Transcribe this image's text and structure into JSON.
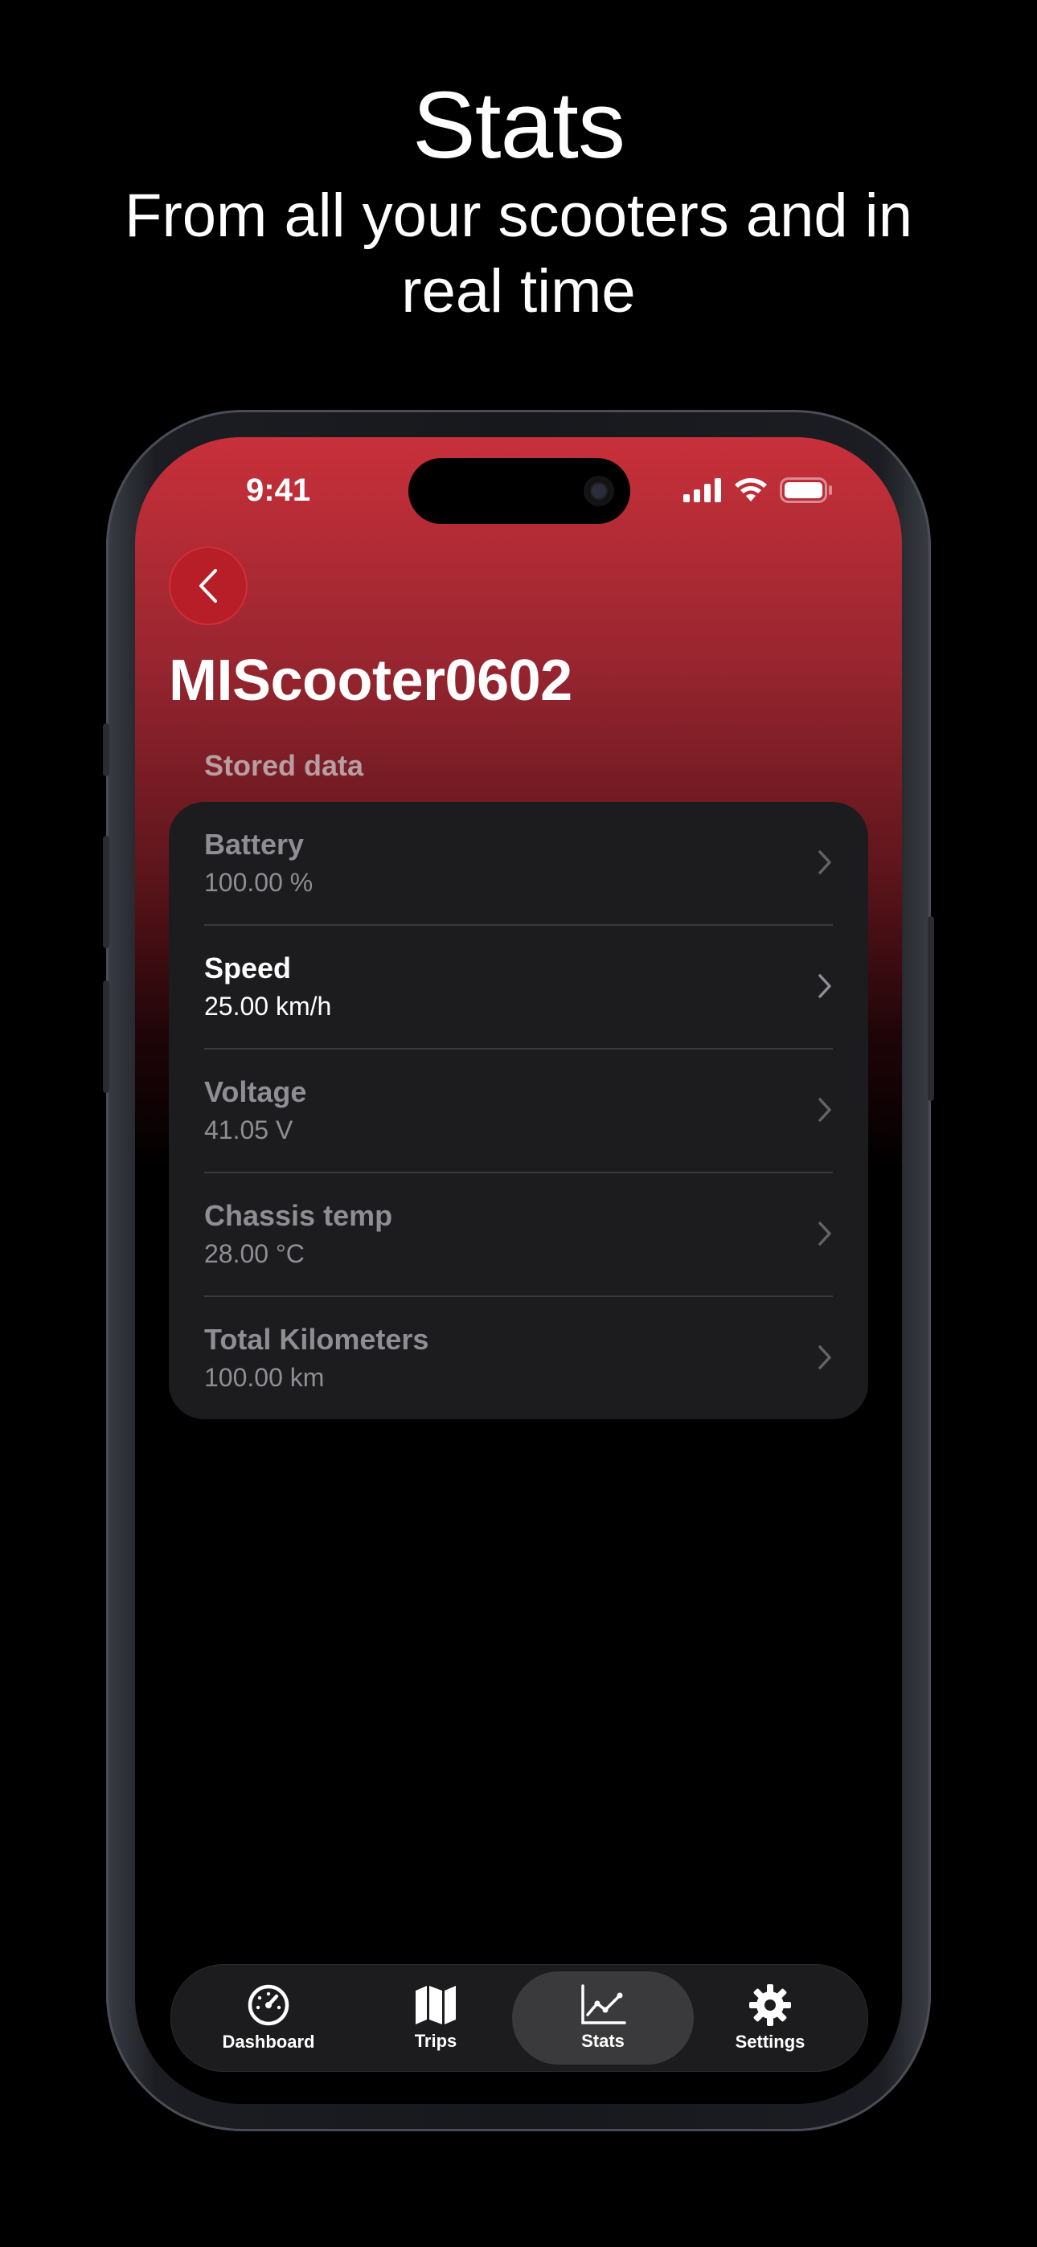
{
  "promo": {
    "headline": "Stats",
    "subheadline": "From all your scooters and in real time"
  },
  "status_bar": {
    "time": "9:41",
    "icons": [
      "cellular-signal-icon",
      "wifi-icon",
      "battery-icon"
    ]
  },
  "header": {
    "back_icon": "chevron-left-icon",
    "title": "MIScooter0602"
  },
  "section": {
    "label": "Stored data"
  },
  "stats": [
    {
      "label": "Battery",
      "value": "100.00 %",
      "active": false
    },
    {
      "label": "Speed",
      "value": "25.00 km/h",
      "active": true
    },
    {
      "label": "Voltage",
      "value": "41.05 V",
      "active": false
    },
    {
      "label": "Chassis temp",
      "value": "28.00 °C",
      "active": false
    },
    {
      "label": "Total Kilometers",
      "value": "100.00 km",
      "active": false
    }
  ],
  "tabbar": {
    "tabs": [
      {
        "label": "Dashboard",
        "icon": "speedometer-icon",
        "selected": false
      },
      {
        "label": "Trips",
        "icon": "map-icon",
        "selected": false
      },
      {
        "label": "Stats",
        "icon": "chart-line-icon",
        "selected": true
      },
      {
        "label": "Settings",
        "icon": "gear-icon",
        "selected": false
      }
    ]
  },
  "colors": {
    "accent": "#c8303a",
    "back_button": "#b81e28",
    "card": "#1c1c1e",
    "muted_text": "#8e8e93"
  }
}
